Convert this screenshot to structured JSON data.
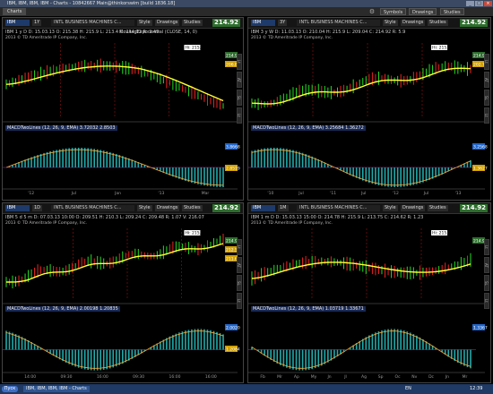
{
  "window": {
    "title": "IBM, IBM, IBM, IBM - Charts - 10842667 Main@thinkorswim [build 1836.18]"
  },
  "tabs": {
    "charts": "Charts",
    "symbols": "Symbols",
    "drawings": "Drawings",
    "studies": "Studies"
  },
  "common": {
    "symbol": "IBM",
    "description": "INTL BUSINESS MACHINES C...",
    "style_label": "Style",
    "drawings_label": "Drawings",
    "studies_label": "Studies",
    "price": "214.92",
    "copyright": "2013 © TD Ameritrade IP Company, Inc.",
    "ema_label": "MovAvgExponential (CLOSE, 14, 0)",
    "hi_label": "Hi: 215.9"
  },
  "panels": [
    {
      "period": "1Y",
      "info": "IBM 1 y D  D: 15.03.13  O: 215.38  H: 215.9  L: 213.4  C: 214.92  R: 2.49",
      "macd": "MACDTwoLines (12, 26, 9, EMA)  3.72032  2.8503",
      "price_labels": [
        "214.92",
        "206.80"
      ],
      "macd_labels": [
        "3.8668",
        "2.8519"
      ],
      "x_labels": [
        "'12",
        "Jul",
        "Jan",
        "'13",
        "Mar"
      ],
      "sides": [
        "Lt",
        "AT",
        "SL",
        "Lt"
      ]
    },
    {
      "period": "3Y",
      "info": "IBM 3 y W  D: 11.03.13  O: 210.04  H: 215.9  L: 209.04  C: 214.92  R: 5.9",
      "macd": "MACDTwoLines (12, 26, 9, EMA)  3.25684  1.36272",
      "price_labels": [
        "214.92",
        "202.76"
      ],
      "macd_labels": [
        "3.2568",
        "1.3627"
      ],
      "x_labels": [
        "'10",
        "Jul",
        "'11",
        "Jul",
        "'12",
        "Jul",
        "'13"
      ],
      "sides": [
        "Lt",
        "AT",
        "SL",
        "Lt"
      ]
    },
    {
      "period": "1D",
      "info": "IBM 5 d 5 m  D: 07.03.13 10:00  O: 209.51  H: 210.3  L: 209.24  C: 209.48  R: 1.07  V: 216.07",
      "macd": "MACDTwoLines (12, 26, 9, EMA)  2.00198  1.20835",
      "price_labels": [
        "214.92",
        "212.5",
        "211.6"
      ],
      "macd_labels": [
        "2.0020",
        "1.2084"
      ],
      "x_labels": [
        "14:00",
        "09:30",
        "16:00",
        "09:30",
        "16:00",
        "16:00"
      ],
      "sides": [
        "Lt",
        "AT",
        "SL",
        "Lt"
      ]
    },
    {
      "period": "1M",
      "info": "IBM 1 m D  D: 15.03.13 15:00  O: 214.78  H: 215.9  L: 213.75  C: 214.62  R: 1.23",
      "macd": "MACDTwoLines (12, 26, 9, EMA)  1.03719  1.33671",
      "price_labels": [
        "214.92"
      ],
      "macd_labels": [
        "1.3367"
      ],
      "x_labels": [
        "Fb",
        "Mr",
        "Ap",
        "My",
        "Jn",
        "Jl",
        "Ag",
        "Sp",
        "Oc",
        "Nv",
        "Dc",
        "Jn",
        "Mr"
      ],
      "sides": [
        "Lt",
        "AT",
        "SL",
        "Lt"
      ]
    }
  ],
  "taskbar": {
    "start": "Пуск",
    "app": "IBM, IBM, IBM, IBM - Charts",
    "lang": "EN",
    "clock": "12:39"
  },
  "colors": {
    "up": "#22dd22",
    "down": "#ee2222",
    "ema": "#ffff33",
    "macd_line": "#ffaa33",
    "hist": "#22aaaa",
    "price_bg": "#2d6e2d"
  }
}
